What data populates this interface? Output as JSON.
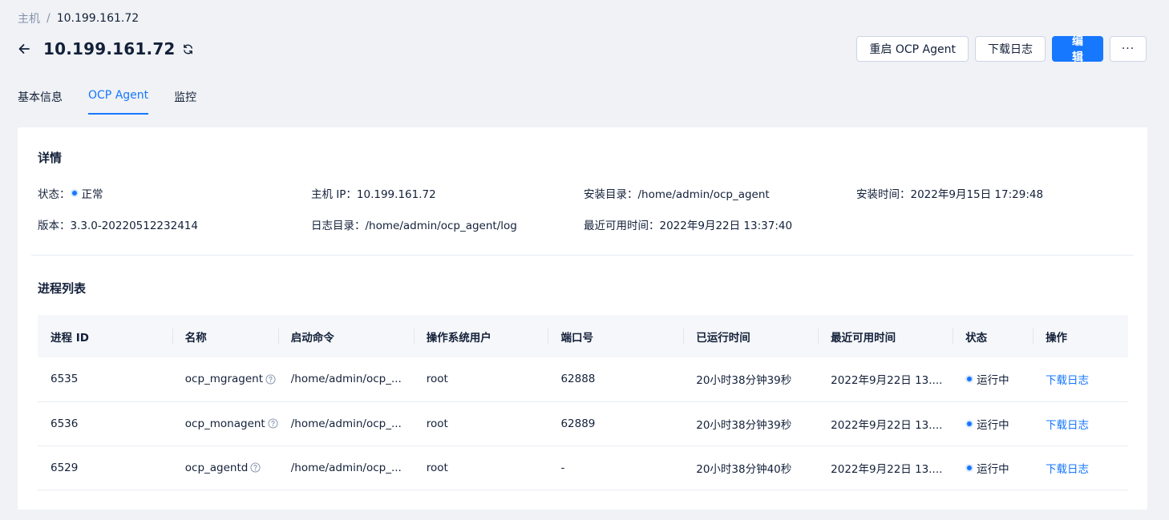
{
  "breadcrumb": {
    "root": "主机",
    "separator": "/",
    "current": "10.199.161.72"
  },
  "header": {
    "title": "10.199.161.72"
  },
  "actions": {
    "restart_label": "重启 OCP Agent",
    "download_label": "下载日志",
    "edit_label": "编 辑",
    "more_label": "···"
  },
  "tabs": [
    {
      "label": "基本信息"
    },
    {
      "label": "OCP Agent",
      "active": true
    },
    {
      "label": "监控"
    }
  ],
  "details": {
    "title": "详情",
    "status_label": "状态：",
    "status_value": "正常",
    "host_ip": "主机 IP：10.199.161.72",
    "install_dir": "安装目录：/home/admin/ocp_agent",
    "install_time": "安装时间：2022年9月15日 17:29:48",
    "version": "版本：3.3.0-20220512232414",
    "log_dir": "日志目录：/home/admin/ocp_agent/log",
    "last_available": "最近可用时间：2022年9月22日 13:37:40"
  },
  "process_list": {
    "title": "进程列表",
    "columns": [
      "进程 ID",
      "名称",
      "启动命令",
      "操作系统用户",
      "端口号",
      "已运行时间",
      "最近可用时间",
      "状态",
      "操作"
    ],
    "rows": [
      {
        "pid": "6535",
        "name": "ocp_mgragent",
        "cmd": "/home/admin/ocp_...",
        "user": "root",
        "port": "62888",
        "uptime": "20小时38分钟39秒",
        "last": "2022年9月22日 13....",
        "status": "运行中",
        "action": "下载日志"
      },
      {
        "pid": "6536",
        "name": "ocp_monagent",
        "cmd": "/home/admin/ocp_...",
        "user": "root",
        "port": "62889",
        "uptime": "20小时38分钟39秒",
        "last": "2022年9月22日 13....",
        "status": "运行中",
        "action": "下载日志"
      },
      {
        "pid": "6529",
        "name": "ocp_agentd",
        "cmd": "/home/admin/ocp_...",
        "user": "root",
        "port": "-",
        "uptime": "20小时38分钟40秒",
        "last": "2022年9月22日 13....",
        "status": "运行中",
        "action": "下载日志"
      }
    ]
  },
  "colors": {
    "accent": "#1677ff",
    "text": "#132039",
    "muted": "#8592ad",
    "background": "#f0f2f5"
  }
}
